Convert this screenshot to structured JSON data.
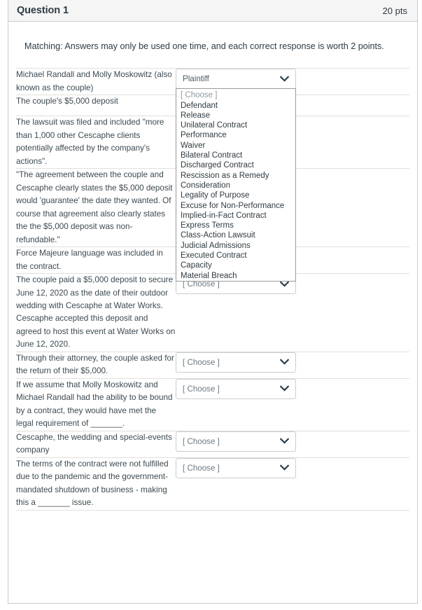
{
  "header": {
    "title": "Question 1",
    "points": "20 pts"
  },
  "instructions": "Matching:  Answers may only be used one time, and each correct response is worth 2 points.",
  "select": {
    "placeholder": "[ Choose ]",
    "chevron_icon": "chevron-down-icon"
  },
  "dropdown": {
    "open": true,
    "selected_value": "Plaintiff",
    "highlight_color": "#1a8cfa",
    "options": [
      "[ Choose ]",
      "Defendant",
      "Release",
      "Unilateral Contract",
      "Performance",
      "Waiver",
      "Bilateral Contract",
      "Discharged Contract",
      "Rescission as a Remedy",
      "Consideration",
      "Legality of Purpose",
      "Excuse for Non-Performance",
      "Implied-in-Fact Contract",
      "Express Terms",
      "Class-Action Lawsuit",
      "Judicial Admissions",
      "Executed Contract",
      "Capacity",
      "Material Breach",
      "Plaintiff"
    ]
  },
  "rows": [
    {
      "prompt": "Michael Randall and Molly Moskowitz (also known as the couple)",
      "answer": "Plaintiff",
      "dropdown_open": true
    },
    {
      "prompt": "The couple's $5,000 deposit",
      "answer": "[ Choose ]",
      "dropdown_open": false
    },
    {
      "prompt": "The lawsuit was filed and included \"more than 1,000 other Cescaphe clients potentially affected by the company's actions\".",
      "answer": "[ Choose ]",
      "dropdown_open": false
    },
    {
      "prompt": "\"The agreement between the couple and Cescaphe clearly states the $5,000 deposit would 'guarantee' the date they wanted. Of course that agreement also clearly states the the $5,000 deposit was non-refundable.\"",
      "answer": "[ Choose ]",
      "dropdown_open": false
    },
    {
      "prompt": "Force Majeure language was included in the contract.",
      "answer": "[ Choose ]",
      "dropdown_open": false
    },
    {
      "prompt": "The couple paid a $5,000 deposit to secure June 12, 2020 as the date of their outdoor wedding with Cescaphe at Water Works. Cescaphe accepted this deposit and agreed to host this event at Water Works on June 12, 2020.",
      "answer": "[ Choose ]",
      "dropdown_open": false
    },
    {
      "prompt": "Through their attorney, the couple asked for the return of their $5,000.",
      "answer": "[ Choose ]",
      "dropdown_open": false
    },
    {
      "prompt": "If we assume that Molly Moskowitz and Michael Randall had the ability to be bound by a contract, they would have met the legal requirement of _______.",
      "answer": "[ Choose ]",
      "dropdown_open": false
    },
    {
      "prompt": "Cescaphe, the wedding and special-events company",
      "answer": "[ Choose ]",
      "dropdown_open": false
    },
    {
      "prompt": "The terms of the contract were not fulfilled due to the pandemic and the government-mandated shutdown of business - making this a _______ issue.",
      "answer": "[ Choose ]",
      "dropdown_open": false
    }
  ]
}
